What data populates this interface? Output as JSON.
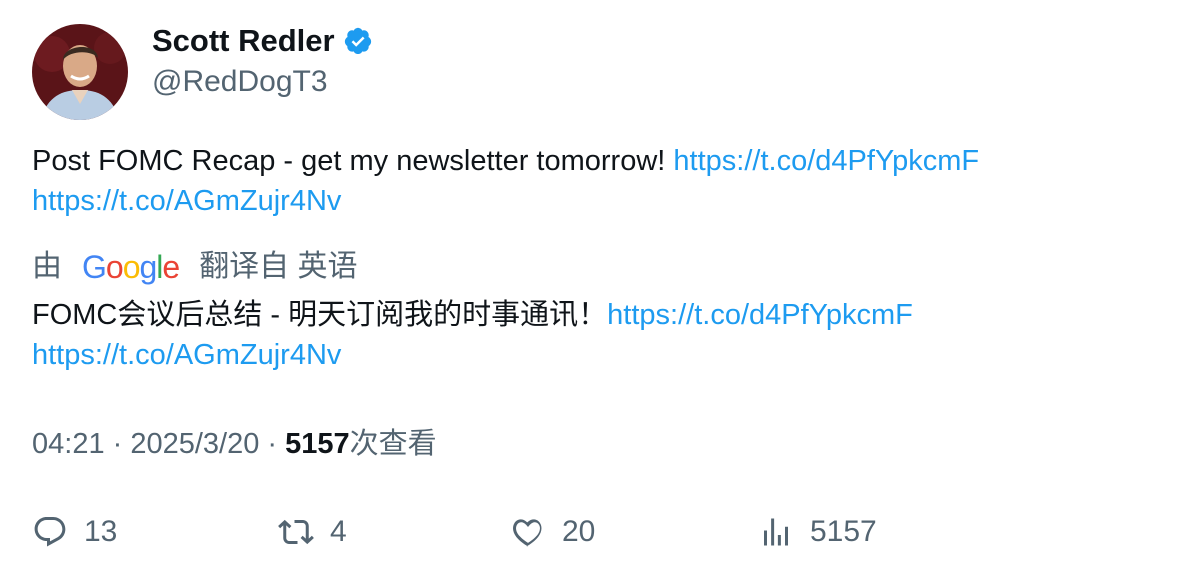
{
  "author": {
    "name": "Scott Redler",
    "handle": "@RedDogT3",
    "verified_icon": "verified-badge-icon"
  },
  "tweet": {
    "text": "Post FOMC Recap - get my newsletter tomorrow! ",
    "link1": "https://t.co/d4PfYpkcmF",
    "link2": "https://t.co/AGmZujr4Nv"
  },
  "translation": {
    "prefix": "由",
    "google_letters": [
      "G",
      "o",
      "o",
      "g",
      "l",
      "e"
    ],
    "suffix": "翻译自 英语",
    "text": "FOMC会议后总结 - 明天订阅我的时事通讯！",
    "link1": "https://t.co/d4PfYpkcmF",
    "link2": "https://t.co/AGmZujr4Nv"
  },
  "meta": {
    "time": "04:21",
    "separator": " · ",
    "date": "2025/3/20",
    "views_count": "5157",
    "views_label": "次查看"
  },
  "actions": {
    "replies": "13",
    "retweets": "4",
    "likes": "20",
    "views": "5157"
  },
  "colors": {
    "link": "#1d9bf0",
    "secondary_text": "#536471",
    "primary_text": "#0f1419",
    "verified": "#1d9bf0"
  }
}
